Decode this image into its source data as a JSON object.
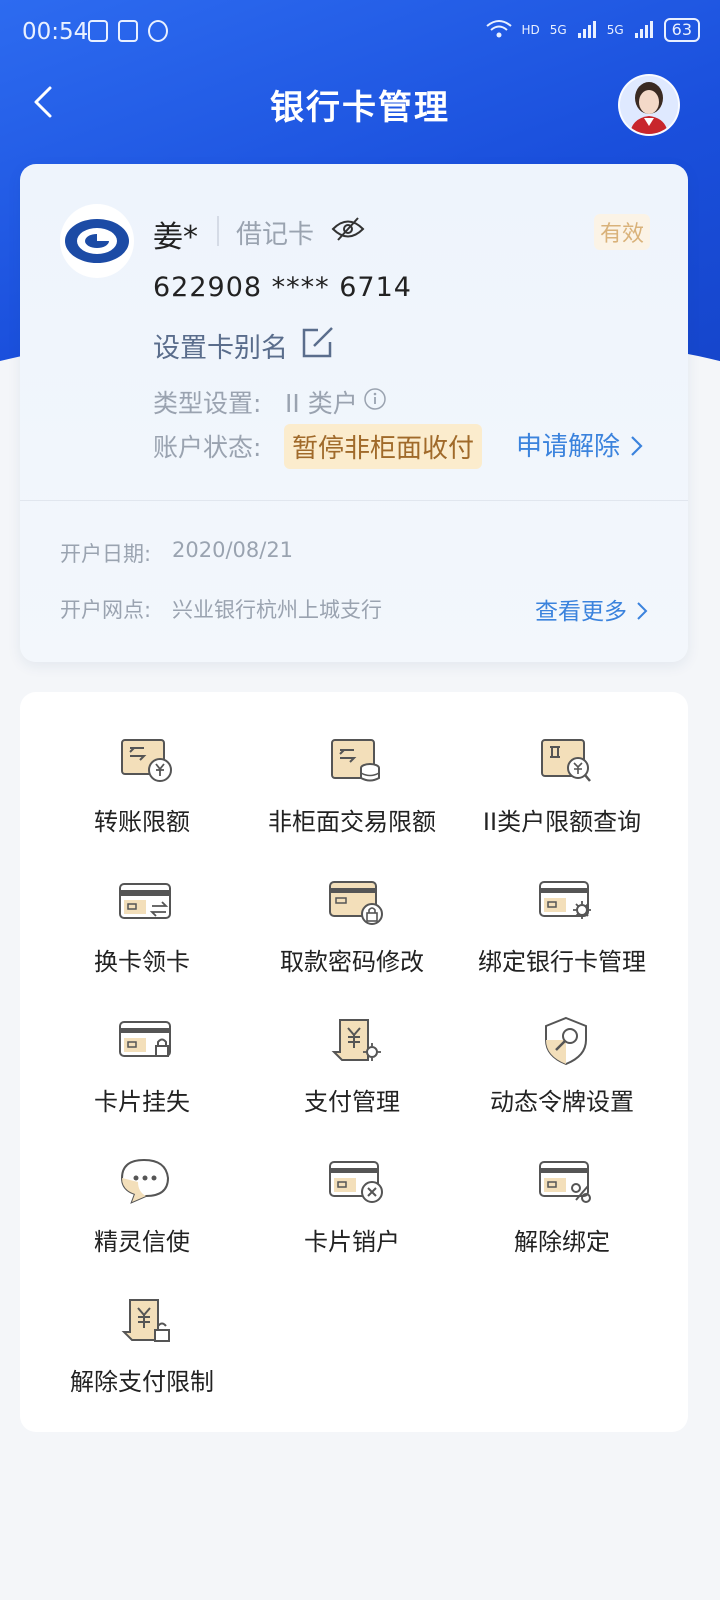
{
  "status_bar": {
    "time": "00:54",
    "network": "5G",
    "hd": "HD",
    "battery": "63"
  },
  "nav": {
    "title": "银行卡管理"
  },
  "card": {
    "holder": "姜*",
    "type": "借记卡",
    "status_badge": "有效",
    "number": "622908 **** 6714",
    "alias_label": "设置卡别名",
    "type_setting_label": "类型设置:",
    "type_setting_value": "II 类户",
    "account_state_label": "账户状态:",
    "account_state_value": "暂停非柜面收付",
    "apply_link": "申请解除",
    "open_date_label": "开户日期:",
    "open_date_value": "2020/08/21",
    "branch_label": "开户网点:",
    "branch_value": "兴业银行杭州上城支行",
    "more_link": "查看更多"
  },
  "functions": [
    {
      "label": "转账限额",
      "icon": "transfer-limit-icon"
    },
    {
      "label": "非柜面交易限额",
      "icon": "non-counter-limit-icon"
    },
    {
      "label": "II类户限额查询",
      "icon": "class-ii-limit-query-icon"
    },
    {
      "label": "换卡领卡",
      "icon": "card-exchange-icon"
    },
    {
      "label": "取款密码修改",
      "icon": "pin-change-icon"
    },
    {
      "label": "绑定银行卡管理",
      "icon": "bound-card-settings-icon"
    },
    {
      "label": "卡片挂失",
      "icon": "card-lock-icon"
    },
    {
      "label": "支付管理",
      "icon": "payment-settings-icon"
    },
    {
      "label": "动态令牌设置",
      "icon": "token-shield-icon"
    },
    {
      "label": "精灵信使",
      "icon": "chat-bubble-icon"
    },
    {
      "label": "卡片销户",
      "icon": "card-close-icon"
    },
    {
      "label": "解除绑定",
      "icon": "unbind-card-icon"
    },
    {
      "label": "解除支付限制",
      "icon": "payment-unlock-icon"
    }
  ],
  "colors": {
    "header_blue": "#1a4fdc",
    "link_blue": "#3b83dd",
    "gold": "#d9b27a",
    "state_bg": "#fbeccd"
  }
}
